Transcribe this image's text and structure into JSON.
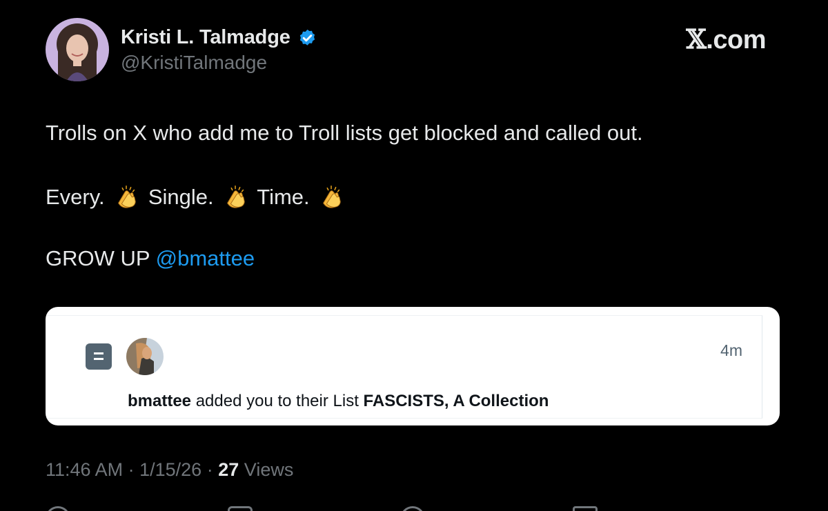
{
  "author": {
    "display_name": "Kristi L. Talmadge",
    "handle": "@KristiTalmadge",
    "verified": true
  },
  "brand": {
    "x_letter": "𝕏",
    "domain": ".com"
  },
  "tweet": {
    "line1": "Trolls on X who add me to Troll lists get blocked and called out.",
    "line2": {
      "word1": "Every.",
      "word2": "Single.",
      "word3": "Time.",
      "emoji": "clapping-hands"
    },
    "line3": {
      "text": "GROW UP",
      "mention": "@bmattee"
    }
  },
  "notification_card": {
    "icon": "list-icon",
    "time": "4m",
    "user": "bmattee",
    "action_text": "added you to their List",
    "list_name": "FASCISTS, A Collection"
  },
  "meta": {
    "time": "11:46 AM",
    "separator": "·",
    "date": "1/15/26",
    "views_count": "27",
    "views_label": "Views"
  },
  "colors": {
    "background": "#000000",
    "text_primary": "#e7e9ea",
    "text_secondary": "#71767b",
    "link": "#1d9bf0",
    "verified_badge": "#1d9bf0",
    "card_background": "#ffffff",
    "card_text": "#0f1419"
  }
}
